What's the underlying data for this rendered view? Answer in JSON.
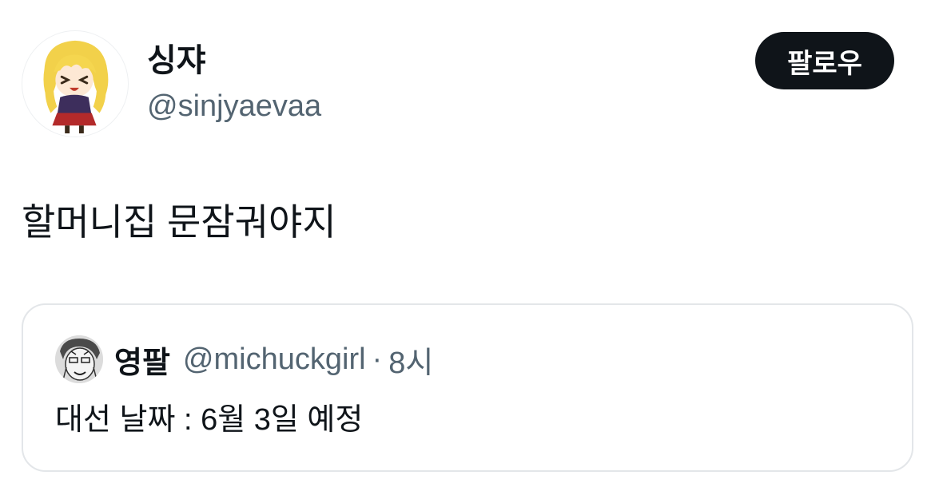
{
  "author": {
    "display_name": "싱쟈",
    "handle": "@sinjyaevaa",
    "avatar_icon": "anime-character-avatar"
  },
  "follow_button": {
    "label": "팔로우",
    "background": "#0f1419",
    "text_color": "#ffffff"
  },
  "tweet": {
    "text": "할머니집 문잠궈야지"
  },
  "quoted_tweet": {
    "display_name": "영팔",
    "handle": "@michuckgirl",
    "separator": "·",
    "time": "8시",
    "text": "대선 날짜 : 6월 3일 예정",
    "avatar_icon": "manga-character-avatar"
  },
  "colors": {
    "primary_text": "#0f1419",
    "secondary_text": "#536471",
    "border": "#e3e6e9"
  }
}
